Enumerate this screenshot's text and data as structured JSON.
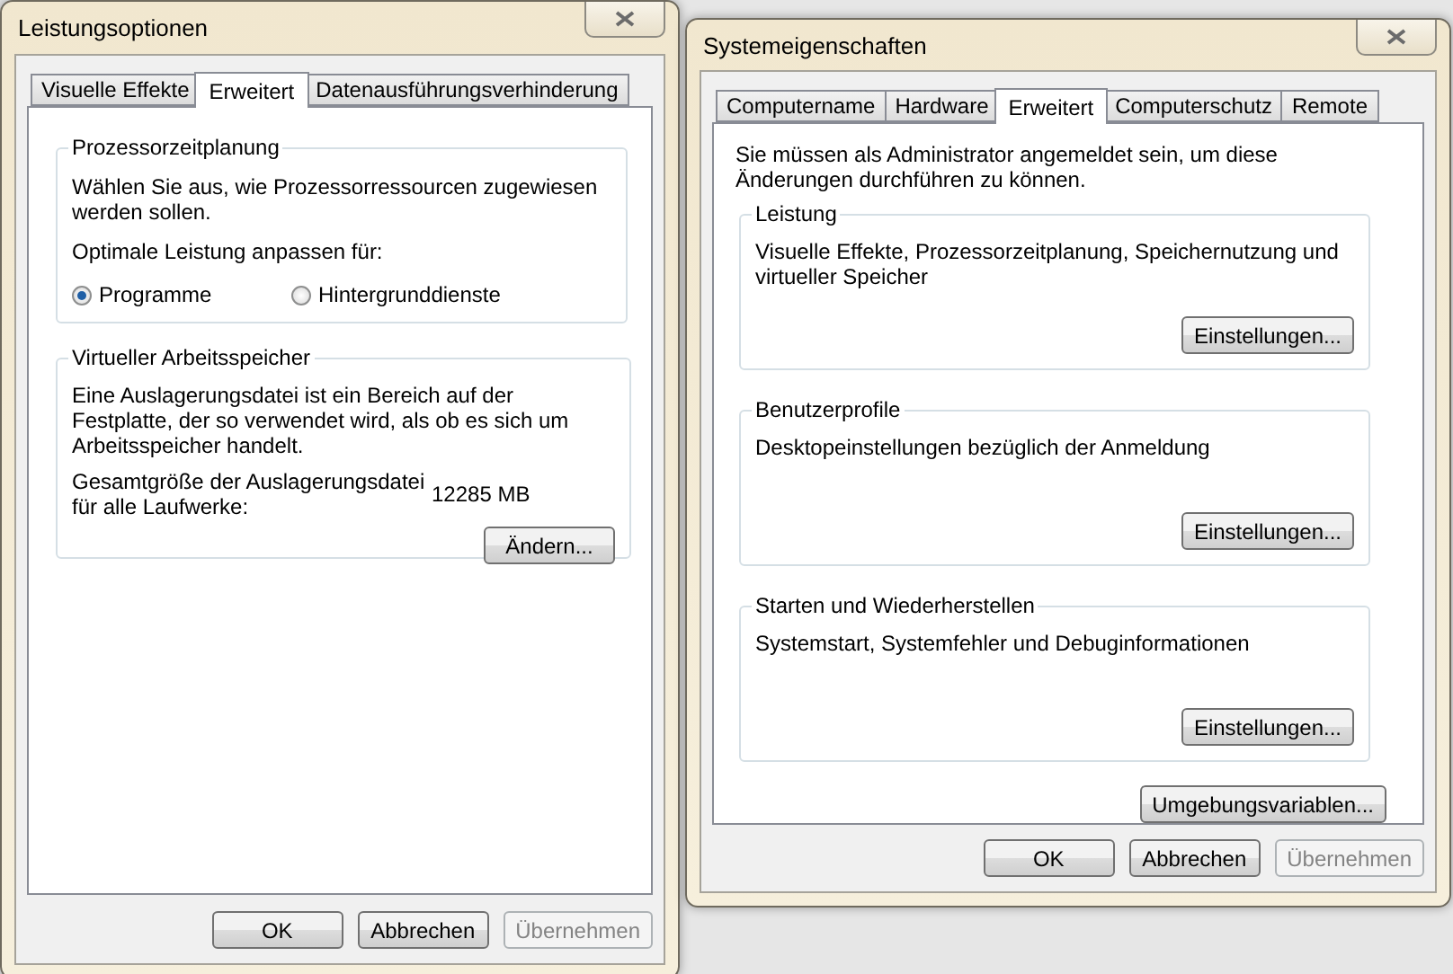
{
  "performance_options": {
    "title": "Leistungsoptionen",
    "tabs": [
      {
        "label": "Visuelle Effekte",
        "selected": false
      },
      {
        "label": "Erweitert",
        "selected": true
      },
      {
        "label": "Datenausführungsverhinderung",
        "selected": false
      }
    ],
    "scheduling": {
      "title": "Prozessorzeitplanung",
      "description": "Wählen Sie aus, wie Prozessorressourcen zugewiesen werden sollen.",
      "prompt": "Optimale Leistung anpassen für:",
      "options": [
        {
          "label": "Programme",
          "selected": true
        },
        {
          "label": "Hintergrunddienste",
          "selected": false
        }
      ]
    },
    "virtual_memory": {
      "title": "Virtueller Arbeitsspeicher",
      "description": "Eine Auslagerungsdatei ist ein Bereich auf der Festplatte, der so verwendet wird, als ob es sich um Arbeitsspeicher handelt.",
      "total_label": "Gesamtgröße der Auslagerungsdatei für alle Laufwerke:",
      "total_value": "12285 MB",
      "button": "Ändern..."
    },
    "buttons": [
      {
        "label": "OK",
        "disabled": false
      },
      {
        "label": "Abbrechen",
        "disabled": false
      },
      {
        "label": "Übernehmen",
        "disabled": true
      }
    ]
  },
  "system_properties": {
    "title": "Systemeigenschaften",
    "tabs": [
      {
        "label": "Computername",
        "selected": false
      },
      {
        "label": "Hardware",
        "selected": false
      },
      {
        "label": "Erweitert",
        "selected": true
      },
      {
        "label": "Computerschutz",
        "selected": false
      },
      {
        "label": "Remote",
        "selected": false
      }
    ],
    "notice": "Sie müssen als Administrator angemeldet sein, um diese Änderungen durchführen zu können.",
    "groups": [
      {
        "title": "Leistung",
        "description": "Visuelle Effekte, Prozessorzeitplanung, Speichernutzung und virtueller Speicher",
        "button": "Einstellungen..."
      },
      {
        "title": "Benutzerprofile",
        "description": "Desktopeinstellungen bezüglich der Anmeldung",
        "button": "Einstellungen..."
      },
      {
        "title": "Starten und Wiederherstellen",
        "description": "Systemstart, Systemfehler und Debuginformationen",
        "button": "Einstellungen..."
      }
    ],
    "env_button": "Umgebungsvariablen...",
    "buttons": [
      {
        "label": "OK",
        "disabled": false
      },
      {
        "label": "Abbrechen",
        "disabled": false
      },
      {
        "label": "Übernehmen",
        "disabled": true
      }
    ]
  }
}
